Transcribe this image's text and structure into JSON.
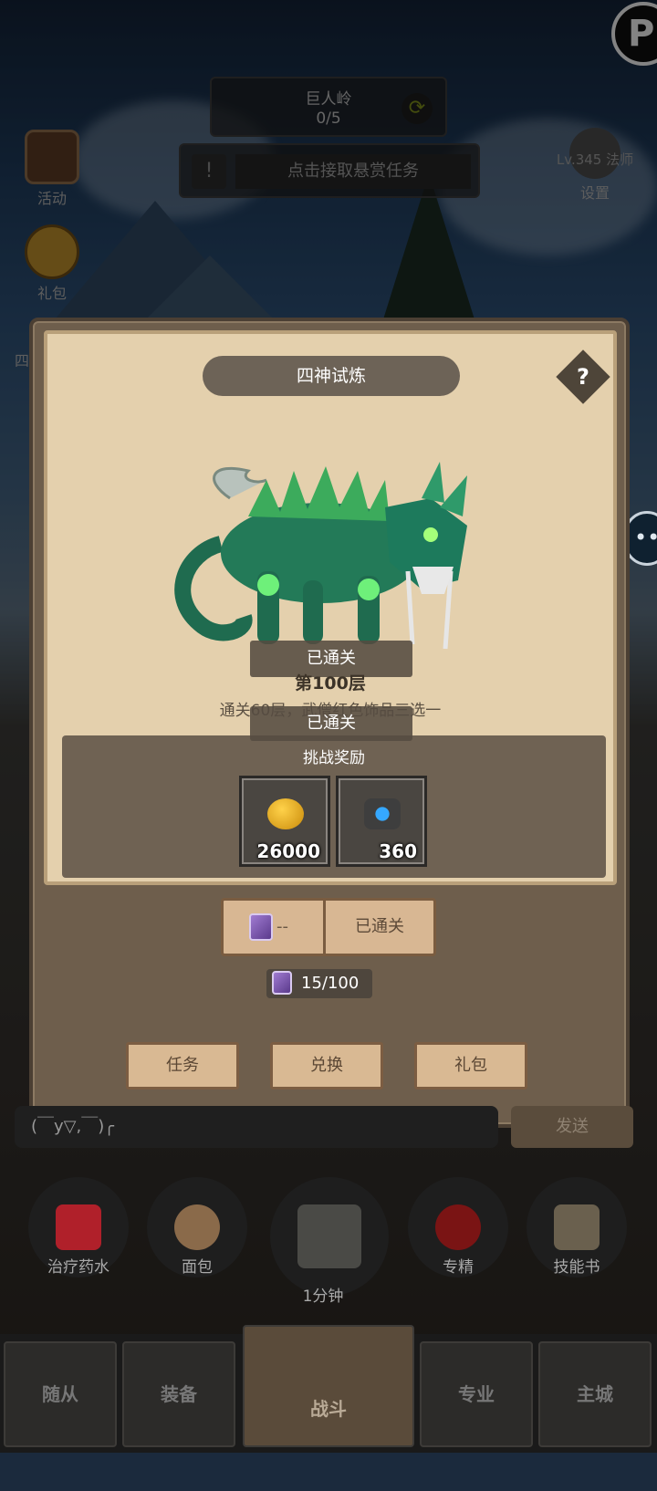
{
  "hud": {
    "location_name": "巨人岭",
    "location_progress": "0/5",
    "bounty_task": "点击接取悬赏任务",
    "level_text": "Lv.345 法师",
    "settings_label": "设置",
    "event_label": "活动",
    "gift_label": "礼包",
    "side_label_cut": "四"
  },
  "panel": {
    "title": "四神试炼",
    "help": "?",
    "cleared_badge": "已通关",
    "floor": "第100层",
    "description": "通关60层，武僧红色饰品三选一",
    "cleared_badge_2": "已通关",
    "reward_label": "挑战奖励",
    "rewards": [
      {
        "icon": "gold-coin-icon",
        "amount": "26000"
      },
      {
        "icon": "blue-gem-icon",
        "amount": "360"
      }
    ],
    "ticket_count": "--",
    "action_label": "已通关",
    "ticket_progress": "15/100",
    "buttons": [
      "任务",
      "兑换",
      "礼包"
    ]
  },
  "chat": {
    "input_text": "(￣y▽,￣)╭",
    "send_label": "发送"
  },
  "items": [
    "治疗药水",
    "面包",
    "1分钟",
    "专精",
    "技能书"
  ],
  "nav": [
    "随从",
    "装备",
    "战斗",
    "专业",
    "主城"
  ]
}
